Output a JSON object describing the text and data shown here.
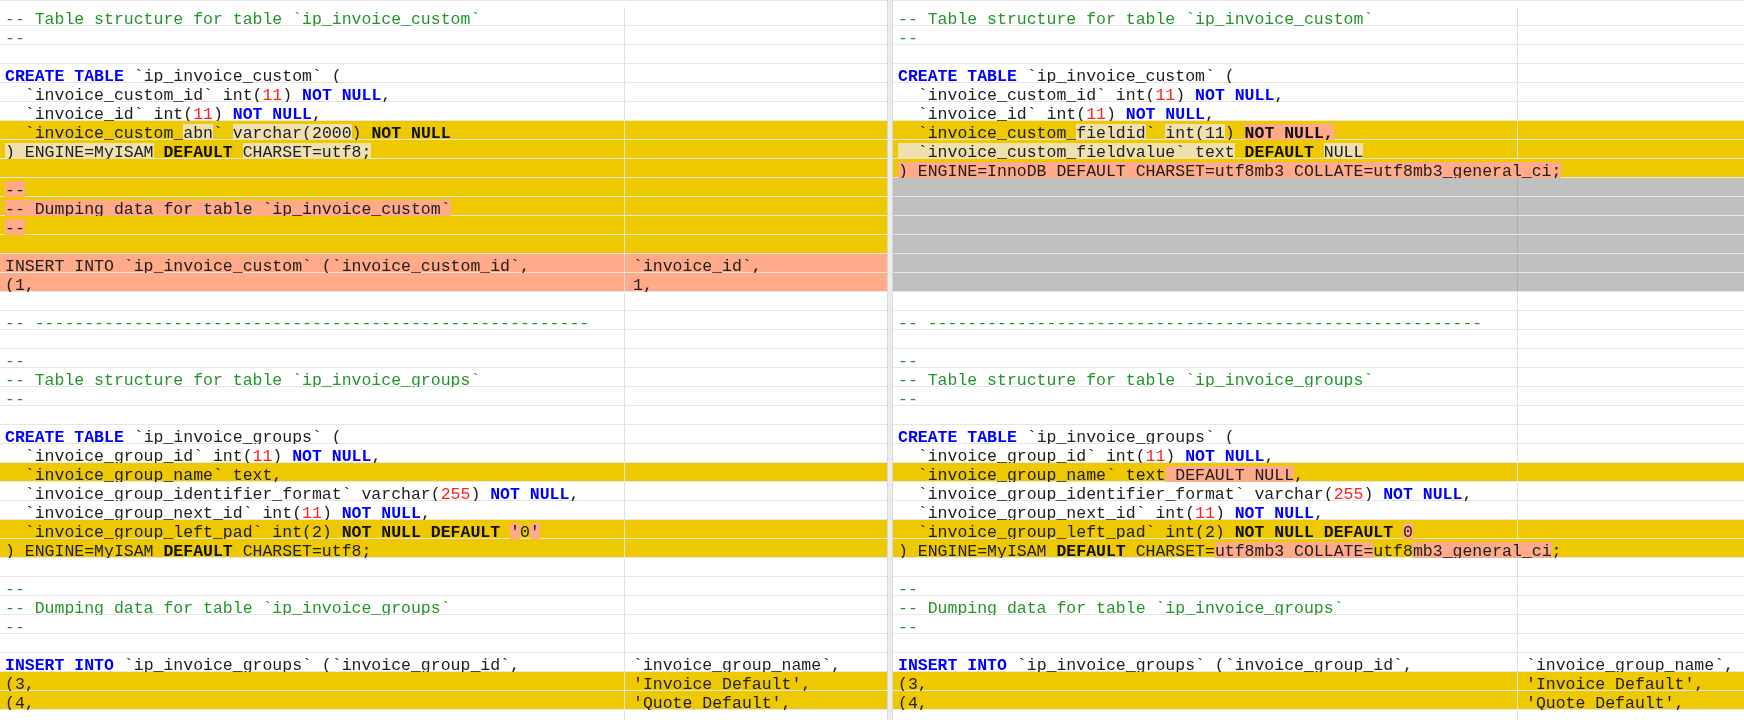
{
  "left": {
    "rows": [
      {
        "kind": "same",
        "line": [
          {
            "text": "-- Table structure for table `ip_invoice_custom`",
            "kind": "comment"
          }
        ]
      },
      {
        "kind": "same",
        "line": [
          {
            "text": "--",
            "kind": "comment"
          }
        ]
      },
      {
        "kind": "same"
      },
      {
        "kind": "same",
        "line": [
          {
            "text": "CREATE TABLE",
            "kind": "keyword"
          },
          {
            "text": " `ip_invoice_custom` (",
            "kind": "plain"
          }
        ]
      },
      {
        "kind": "same",
        "line": [
          {
            "text": "  `invoice_custom_id` int(",
            "kind": "plain"
          },
          {
            "text": "11",
            "kind": "number"
          },
          {
            "text": ") ",
            "kind": "plain"
          },
          {
            "text": "NOT NULL",
            "kind": "keyword"
          },
          {
            "text": ",",
            "kind": "plain"
          }
        ]
      },
      {
        "kind": "same",
        "line": [
          {
            "text": "  `invoice_id` int(",
            "kind": "plain"
          },
          {
            "text": "11",
            "kind": "number"
          },
          {
            "text": ") ",
            "kind": "plain"
          },
          {
            "text": "NOT NULL",
            "kind": "keyword"
          },
          {
            "text": ",",
            "kind": "plain"
          }
        ]
      },
      {
        "kind": "changed",
        "line": [
          {
            "text": "  `invoice_custom_",
            "kind": "plain"
          },
          {
            "text": "abn",
            "kind": "plain",
            "color": "#f0e0b0"
          },
          {
            "text": "` ",
            "kind": "plain"
          },
          {
            "text": "varchar(2000",
            "kind": "plain",
            "color": "#f0e0b0"
          },
          {
            "text": ") ",
            "kind": "plain"
          },
          {
            "text": "NOT NULL",
            "kind": "bold"
          }
        ]
      },
      {
        "kind": "changed",
        "line": [
          {
            "text": ") ENGINE=MyISAM",
            "kind": "plain",
            "color": "#f0e0b0"
          },
          {
            "text": " DEFAULT ",
            "kind": "bold"
          },
          {
            "text": "CHARSET=utf8;",
            "kind": "plain",
            "color": "#f0e0b0"
          }
        ]
      },
      {
        "kind": "changed"
      },
      {
        "kind": "changed",
        "line": [
          {
            "text": "--",
            "kind": "plain",
            "color": "#ffaa88"
          }
        ]
      },
      {
        "kind": "changed",
        "line": [
          {
            "text": "-- Dumping data for table `ip_invoice_custom`",
            "kind": "plain",
            "color": "#ffaa88"
          }
        ]
      },
      {
        "kind": "changed",
        "line": [
          {
            "text": "--",
            "kind": "plain",
            "color": "#ffaa88"
          }
        ]
      },
      {
        "kind": "changed"
      },
      {
        "kind": "removed",
        "line": [
          {
            "text": "INSERT INTO `ip_invoice_custom` (`invoice_custom_id`,",
            "kind": "plain"
          }
        ],
        "line_2": [
          {
            "text": "`invoice_id`,",
            "kind": "plain"
          }
        ]
      },
      {
        "kind": "removed",
        "line": [
          {
            "text": "(1,",
            "kind": "plain"
          }
        ],
        "line_2": [
          {
            "text": "1,",
            "kind": "plain"
          }
        ]
      },
      {
        "kind": "same"
      },
      {
        "kind": "same",
        "line": [
          {
            "text": "-- --------------------------------------------------------",
            "kind": "comment"
          }
        ]
      },
      {
        "kind": "same"
      },
      {
        "kind": "same",
        "line": [
          {
            "text": "--",
            "kind": "comment"
          }
        ]
      },
      {
        "kind": "same",
        "line": [
          {
            "text": "-- Table structure for table `ip_invoice_groups`",
            "kind": "comment"
          }
        ]
      },
      {
        "kind": "same",
        "line": [
          {
            "text": "--",
            "kind": "comment"
          }
        ]
      },
      {
        "kind": "same"
      },
      {
        "kind": "same",
        "line": [
          {
            "text": "CREATE TABLE",
            "kind": "keyword"
          },
          {
            "text": " `ip_invoice_groups` (",
            "kind": "plain"
          }
        ]
      },
      {
        "kind": "same",
        "line": [
          {
            "text": "  `invoice_group_id` int(",
            "kind": "plain"
          },
          {
            "text": "11",
            "kind": "number"
          },
          {
            "text": ") ",
            "kind": "plain"
          },
          {
            "text": "NOT NULL",
            "kind": "keyword"
          },
          {
            "text": ",",
            "kind": "plain"
          }
        ]
      },
      {
        "kind": "changed",
        "line": [
          {
            "text": "  `invoice_group_name` text,",
            "kind": "plain"
          }
        ]
      },
      {
        "kind": "same",
        "line": [
          {
            "text": "  `invoice_group_identifier_format` varchar(",
            "kind": "plain"
          },
          {
            "text": "255",
            "kind": "number"
          },
          {
            "text": ") ",
            "kind": "plain"
          },
          {
            "text": "NOT NULL",
            "kind": "keyword"
          },
          {
            "text": ",",
            "kind": "plain"
          }
        ]
      },
      {
        "kind": "same",
        "line": [
          {
            "text": "  `invoice_group_next_id` int(",
            "kind": "plain"
          },
          {
            "text": "11",
            "kind": "number"
          },
          {
            "text": ") ",
            "kind": "plain"
          },
          {
            "text": "NOT NULL",
            "kind": "keyword"
          },
          {
            "text": ",",
            "kind": "plain"
          }
        ]
      },
      {
        "kind": "changed",
        "line": [
          {
            "text": "  `invoice_group_left_pad` int(2) ",
            "kind": "plain"
          },
          {
            "text": "NOT NULL DEFAULT ",
            "kind": "bold"
          },
          {
            "text": "'",
            "kind": "plain",
            "color": "#ffaa88"
          },
          {
            "text": "0",
            "kind": "plain"
          },
          {
            "text": "'",
            "kind": "plain",
            "color": "#ffaa88"
          }
        ]
      },
      {
        "kind": "changed",
        "line": [
          {
            "text": ") ENGINE=MyISAM ",
            "kind": "plain"
          },
          {
            "text": "DEFAULT",
            "kind": "bold"
          },
          {
            "text": " CHARSET=utf8;",
            "kind": "plain"
          }
        ]
      },
      {
        "kind": "same"
      },
      {
        "kind": "same",
        "line": [
          {
            "text": "--",
            "kind": "comment"
          }
        ]
      },
      {
        "kind": "same",
        "line": [
          {
            "text": "-- Dumping data for table `ip_invoice_groups`",
            "kind": "comment"
          }
        ]
      },
      {
        "kind": "same",
        "line": [
          {
            "text": "--",
            "kind": "comment"
          }
        ]
      },
      {
        "kind": "same"
      },
      {
        "kind": "same",
        "line": [
          {
            "text": "INSERT INTO",
            "kind": "keyword"
          },
          {
            "text": " `ip_invoice_groups` (`invoice_group_id`,",
            "kind": "plain"
          }
        ],
        "line_2": [
          {
            "text": "`invoice_group_name`,",
            "kind": "plain"
          }
        ]
      },
      {
        "kind": "changed",
        "line": [
          {
            "text": "(3,",
            "kind": "plain"
          }
        ],
        "line_2": [
          {
            "text": "'Invoice Default',",
            "kind": "plain"
          }
        ]
      },
      {
        "kind": "changed",
        "line": [
          {
            "text": "(4,",
            "kind": "plain"
          }
        ],
        "line_2": [
          {
            "text": "'Quote Default',",
            "kind": "plain"
          }
        ]
      },
      {
        "kind": "same"
      }
    ]
  },
  "right": {
    "rows": [
      {
        "kind": "same",
        "line": [
          {
            "text": "-- Table structure for table `ip_invoice_custom`",
            "kind": "comment"
          }
        ]
      },
      {
        "kind": "same",
        "line": [
          {
            "text": "--",
            "kind": "comment"
          }
        ]
      },
      {
        "kind": "same"
      },
      {
        "kind": "same",
        "line": [
          {
            "text": "CREATE TABLE",
            "kind": "keyword"
          },
          {
            "text": " `ip_invoice_custom` (",
            "kind": "plain"
          }
        ]
      },
      {
        "kind": "same",
        "line": [
          {
            "text": "  `invoice_custom_id` int(",
            "kind": "plain"
          },
          {
            "text": "11",
            "kind": "number"
          },
          {
            "text": ") ",
            "kind": "plain"
          },
          {
            "text": "NOT NULL",
            "kind": "keyword"
          },
          {
            "text": ",",
            "kind": "plain"
          }
        ]
      },
      {
        "kind": "same",
        "line": [
          {
            "text": "  `invoice_id` int(",
            "kind": "plain"
          },
          {
            "text": "11",
            "kind": "number"
          },
          {
            "text": ") ",
            "kind": "plain"
          },
          {
            "text": "NOT NULL",
            "kind": "keyword"
          },
          {
            "text": ",",
            "kind": "plain"
          }
        ]
      },
      {
        "kind": "changed",
        "line": [
          {
            "text": "  `invoice_custom_",
            "kind": "plain"
          },
          {
            "text": "fieldid",
            "kind": "plain",
            "color": "#f0e0b0"
          },
          {
            "text": "` ",
            "kind": "plain"
          },
          {
            "text": "int(11",
            "kind": "plain",
            "color": "#f0e0b0"
          },
          {
            "text": ") ",
            "kind": "plain"
          },
          {
            "text": "NOT NULL,",
            "kind": "bold",
            "color": "#ffaa88"
          }
        ]
      },
      {
        "kind": "changed",
        "line": [
          {
            "text": "  `invoice_custom_fieldvalue`",
            "kind": "plain",
            "color": "#f0e0b0"
          },
          {
            "text": " text",
            "kind": "plain",
            "color": "#f0e0b0"
          },
          {
            "text": " DEFAULT ",
            "kind": "bold"
          },
          {
            "text": "NULL",
            "kind": "plain",
            "color": "#f0e0b0"
          }
        ]
      },
      {
        "kind": "changed",
        "line": [
          {
            "text": ") ENGINE=InnoDB DEFAULT CHARSET=utf8mb3 COLLATE=utf8mb3_general_ci;",
            "kind": "plain",
            "color": "#ffaa88"
          }
        ]
      },
      {
        "kind": "filler"
      },
      {
        "kind": "filler"
      },
      {
        "kind": "filler"
      },
      {
        "kind": "filler"
      },
      {
        "kind": "filler"
      },
      {
        "kind": "filler"
      },
      {
        "kind": "same"
      },
      {
        "kind": "same",
        "line": [
          {
            "text": "-- --------------------------------------------------------",
            "kind": "comment"
          }
        ]
      },
      {
        "kind": "same"
      },
      {
        "kind": "same",
        "line": [
          {
            "text": "--",
            "kind": "comment"
          }
        ]
      },
      {
        "kind": "same",
        "line": [
          {
            "text": "-- Table structure for table `ip_invoice_groups`",
            "kind": "comment"
          }
        ]
      },
      {
        "kind": "same",
        "line": [
          {
            "text": "--",
            "kind": "comment"
          }
        ]
      },
      {
        "kind": "same"
      },
      {
        "kind": "same",
        "line": [
          {
            "text": "CREATE TABLE",
            "kind": "keyword"
          },
          {
            "text": " `ip_invoice_groups` (",
            "kind": "plain"
          }
        ]
      },
      {
        "kind": "same",
        "line": [
          {
            "text": "  `invoice_group_id` int(",
            "kind": "plain"
          },
          {
            "text": "11",
            "kind": "number"
          },
          {
            "text": ") ",
            "kind": "plain"
          },
          {
            "text": "NOT NULL",
            "kind": "keyword"
          },
          {
            "text": ",",
            "kind": "plain"
          }
        ]
      },
      {
        "kind": "changed",
        "line": [
          {
            "text": "  `invoice_group_name` text",
            "kind": "plain"
          },
          {
            "text": " DEFAULT NULL",
            "kind": "plain",
            "color": "#ffaa88"
          },
          {
            "text": ",",
            "kind": "plain"
          }
        ]
      },
      {
        "kind": "same",
        "line": [
          {
            "text": "  `invoice_group_identifier_format` varchar(",
            "kind": "plain"
          },
          {
            "text": "255",
            "kind": "number"
          },
          {
            "text": ") ",
            "kind": "plain"
          },
          {
            "text": "NOT NULL",
            "kind": "keyword"
          },
          {
            "text": ",",
            "kind": "plain"
          }
        ]
      },
      {
        "kind": "same",
        "line": [
          {
            "text": "  `invoice_group_next_id` int(",
            "kind": "plain"
          },
          {
            "text": "11",
            "kind": "number"
          },
          {
            "text": ") ",
            "kind": "plain"
          },
          {
            "text": "NOT NULL",
            "kind": "keyword"
          },
          {
            "text": ",",
            "kind": "plain"
          }
        ]
      },
      {
        "kind": "changed",
        "line": [
          {
            "text": "  `invoice_group_left_pad` int(2) ",
            "kind": "plain"
          },
          {
            "text": "NOT NULL DEFAULT ",
            "kind": "bold"
          },
          {
            "text": "0",
            "kind": "plain",
            "color": "#ffaa88"
          }
        ]
      },
      {
        "kind": "changed",
        "line": [
          {
            "text": ") ENGINE=MyISAM ",
            "kind": "plain"
          },
          {
            "text": "DEFAULT",
            "kind": "bold"
          },
          {
            "text": " CHARSET=",
            "kind": "plain"
          },
          {
            "text": "utf8mb3 COLLATE=",
            "kind": "plain",
            "color": "#ffaa88"
          },
          {
            "text": "utf8",
            "kind": "plain"
          },
          {
            "text": "mb3_general_ci",
            "kind": "plain",
            "color": "#ffaa88"
          },
          {
            "text": ";",
            "kind": "plain"
          }
        ]
      },
      {
        "kind": "same"
      },
      {
        "kind": "same",
        "line": [
          {
            "text": "--",
            "kind": "comment"
          }
        ]
      },
      {
        "kind": "same",
        "line": [
          {
            "text": "-- Dumping data for table `ip_invoice_groups`",
            "kind": "comment"
          }
        ]
      },
      {
        "kind": "same",
        "line": [
          {
            "text": "--",
            "kind": "comment"
          }
        ]
      },
      {
        "kind": "same"
      },
      {
        "kind": "same",
        "line": [
          {
            "text": "INSERT INTO",
            "kind": "keyword"
          },
          {
            "text": " `ip_invoice_groups` (`invoice_group_id`,",
            "kind": "plain"
          }
        ],
        "line_2": [
          {
            "text": "`invoice_group_name`,",
            "kind": "plain"
          }
        ]
      },
      {
        "kind": "changed",
        "line": [
          {
            "text": "(3,",
            "kind": "plain"
          }
        ],
        "line_2": [
          {
            "text": "'Invoice Default',",
            "kind": "plain"
          }
        ]
      },
      {
        "kind": "changed",
        "line": [
          {
            "text": "(4,",
            "kind": "plain"
          }
        ],
        "line_2": [
          {
            "text": "'Quote Default',",
            "kind": "plain"
          }
        ]
      },
      {
        "kind": "same"
      }
    ]
  }
}
